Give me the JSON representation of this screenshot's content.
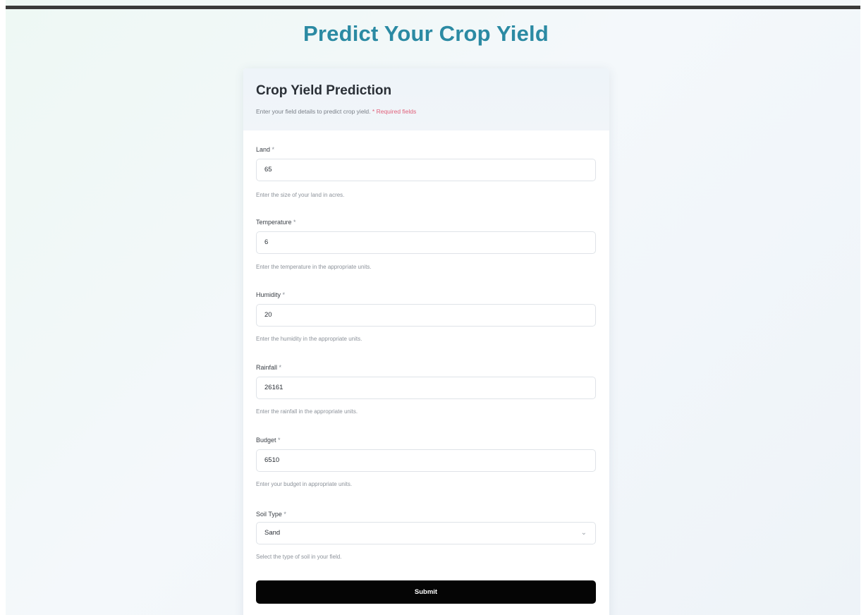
{
  "page": {
    "title": "Predict Your Crop Yield"
  },
  "card": {
    "title": "Crop Yield Prediction",
    "description": "Enter your field details to predict crop yield.",
    "required_note": "* Required fields"
  },
  "fields": {
    "land": {
      "label": "Land",
      "required_mark": "*",
      "value": "65",
      "help": "Enter the size of your land in acres."
    },
    "temperature": {
      "label": "Temperature",
      "required_mark": "*",
      "value": "6",
      "help": "Enter the temperature in the appropriate units."
    },
    "humidity": {
      "label": "Humidity",
      "required_mark": "*",
      "value": "20",
      "help": "Enter the humidity in the appropriate units."
    },
    "rainfall": {
      "label": "Rainfall",
      "required_mark": "*",
      "value": "26161",
      "help": "Enter the rainfall in the appropriate units."
    },
    "budget": {
      "label": "Budget",
      "required_mark": "*",
      "value": "6510",
      "help": "Enter your budget in appropriate units."
    },
    "soil_type": {
      "label": "Soil Type",
      "required_mark": "*",
      "selected": "Sand",
      "help": "Select the type of soil in your field."
    }
  },
  "submit": {
    "label": "Submit"
  },
  "icons": {
    "select_chevron": "chevron-down-icon"
  },
  "colors": {
    "title": "#2b8aa3",
    "required": "#e0607a",
    "button": "#050505",
    "top_bar": "#3a3a3a"
  }
}
